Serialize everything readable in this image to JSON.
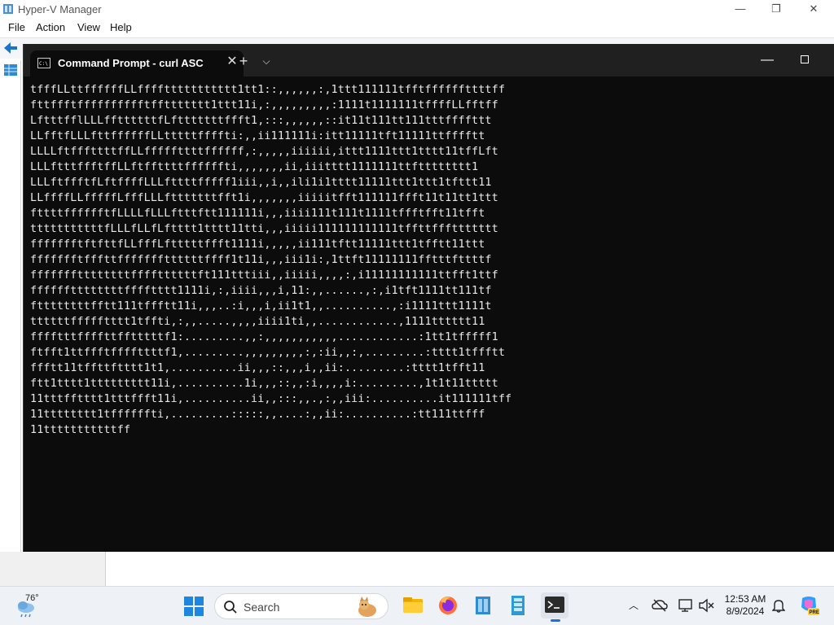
{
  "hyperv": {
    "title": "Hyper-V Manager",
    "window_controls": {
      "minimize": "—",
      "restore": "❐",
      "close": "✕"
    },
    "menu": [
      "File",
      "Action",
      "View",
      "Help"
    ]
  },
  "cmd": {
    "tab_title": "Command Prompt - curl  ASC",
    "tab_close": "✕",
    "new_tab": "+",
    "dropdown": "⌵",
    "minimize": "—",
    "output_lines": [
      "tfffLLttffffffLLffffttttttttttt1tt1::,,,,,,:,1ttt111111tfftffffffttttff",
      "fttffftfffffffffftffttttttt1ttt11i,:,,,,,,,,,:1111t1111111tffffLLfftff",
      "Lftttffl​LLLffttttttfLftttttttffft1,:::,,,,,,::it11t111tt111tttffffttt",
      "LLfftfLLLfttffffffLLtttttffffti:,,ii111111i:itt11111tft11111ttfffftt",
      "LLLLftfffttttffLLfffffttttffffff,:,,,,,iiiiii,ittt1111ttt1tttt11tffLft",
      "LLLftttffftffLLftffttttffffffti,,,,,,,ii,iiitttt1111111ttftttttttt1",
      "LLLftffftfLftffffLLLfttttfffff1iii,,i,,ili1i1tttt11111ttt1ttt1tfttt11",
      "LLffffLLfffffLfffLLLftttttttfft1i,,,,,,,iiiiitfft111111ffft11t11tt1ttt",
      "fttttfffffftfLLLLfLLLftttftt111111i,,,iiii111t111t1111tffftfft11tfft",
      "tttttttttttfLLLfLLfLftttt1tttt11tti,,,iiiii111111111111tffttfffttttttt",
      "ffffffftftfttfLLfffLftttttffft1111i,,,,,ii111tftt11111ttt1tfftt11ttt",
      "ffffffftfffttfffffffttttttffff1t11i,,,iii1i:,1ttft11111111fftttfttttf",
      "fffffffttttttttffffttttttft111tttiii,,iiiii,,,,:,i11111111111ttfft1ttf",
      "ffffffttttttttfffftttt1111i,:,iiii,,,i,11:,,......,:,i1tft1111tt111tf",
      "fttttttttfftt111tffftt11i,,,..:i,,,i,ii1t1,,..........,:i1111ttt1111t",
      "ttttttffffftttt1tffti,:,,.....,,,,iiii1ti,,............,1111tttttt11",
      "fffftttffffttfftttttf1:.........,,:,,,,,,,,,,,............:1tt1tfffff1",
      "ftfft1ttffftffffttttf1,.........,,,,,,,,,:,:ii,,:,.........:tttt1tffftt",
      "ffftt11tffttftttt1t1,..........ii,,,::,,,i,,ii:.........:tttt1tfft11",
      "ftt1tttt1ttttttttt11i,..........1i,,,::,,:i,,,,i:.........,1t1t11ttttt",
      "11tttfftttt1tttffft11i,..........ii,,:::,,.,:,,iii:..........it111111tff",
      "11tttttttt1tffffffti,.........:::::,,....:,,ii:..........:tt111ttfff",
      "11tttttttttttff"
    ]
  },
  "taskbar": {
    "weather_temp": "76°",
    "search_placeholder": "Search",
    "clock_time": "12:53 AM",
    "clock_date": "8/9/2024"
  }
}
